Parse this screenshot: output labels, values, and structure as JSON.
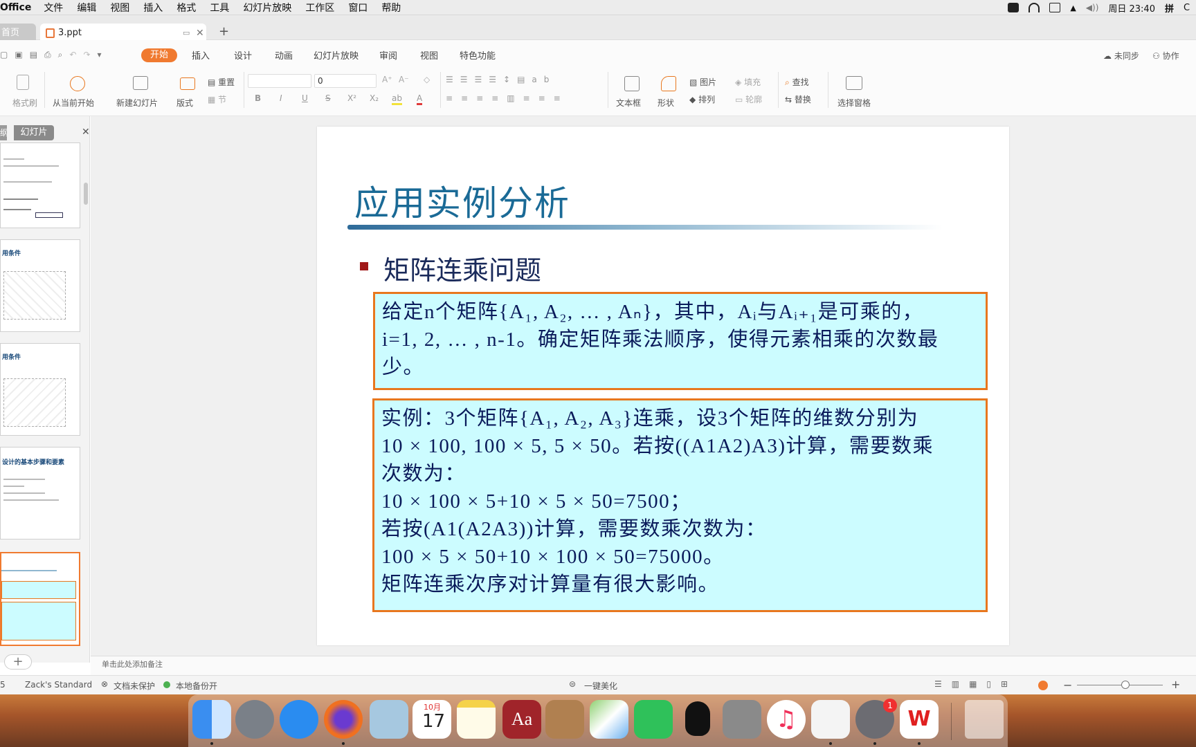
{
  "menubar": {
    "app": "Office",
    "items": [
      "文件",
      "编辑",
      "视图",
      "插入",
      "格式",
      "工具",
      "幻灯片放映",
      "工作区",
      "窗口",
      "帮助"
    ],
    "clock": "周日 23:40",
    "ime": "拼"
  },
  "tabs": {
    "home": "首页",
    "file": "3.ppt"
  },
  "ribbon": {
    "tabs": [
      "开始",
      "插入",
      "设计",
      "动画",
      "幻灯片放映",
      "审阅",
      "视图",
      "特色功能"
    ],
    "sync": "未同步",
    "collab": "协作",
    "format_painter": "格式刷",
    "play_from_current": "从当前开始",
    "new_slide": "新建幻灯片",
    "layout": "版式",
    "reset": "重置",
    "section": "节",
    "font_size": "0",
    "textbox": "文本框",
    "shape": "形状",
    "picture": "图片",
    "fill": "填充",
    "arrange": "排列",
    "outline": "轮廓",
    "find": "查找",
    "replace": "替换",
    "select_pane": "选择窗格"
  },
  "left_panel": {
    "tab_outline": "纲",
    "tab_slides": "幻灯片",
    "thumb1_title": "用条件",
    "thumb2_title": "用条件",
    "thumb3_title": "用条件",
    "thumb4_title": "设计的基本步骤和要素"
  },
  "slide": {
    "title": "应用实例分析",
    "bullet": "矩阵连乘问题",
    "box1_lines": [
      "给定n个矩阵{A₁, A₂, … , Aₙ}，其中，Aᵢ与Aᵢ₊₁是可乘的，",
      "i=1, 2, … , n-1。确定矩阵乘法顺序，使得元素相乘的次数最",
      "少。"
    ],
    "box2_lines": [
      "实例：3个矩阵{A₁, A₂, A₃}连乘，设3个矩阵的维数分别为",
      "10 × 100, 100 × 5, 5 × 50。若按((A1A2)A3)计算，需要数乘",
      "次数为：",
      "10 × 100 × 5+10 × 5 × 50=7500；",
      "若按(A1(A2A3))计算，需要数乘次数为：",
      "100 × 5 × 50+10 × 100 × 50=75000。",
      "矩阵连乘次序对计算量有很大影响。"
    ]
  },
  "notes_placeholder": "单击此处添加备注",
  "status": {
    "slide_no": "5",
    "theme": "Zack's Standard",
    "protect": "文档未保护",
    "backup": "本地备份开",
    "beautify": "一键美化"
  },
  "dock": {
    "calendar_month": "10月",
    "calendar_day": "17",
    "badge": "1"
  },
  "colors": {
    "accent": "#f07a30",
    "box_border": "#e8771e",
    "box_fill": "#ccfcff",
    "title": "#1a6a96"
  }
}
